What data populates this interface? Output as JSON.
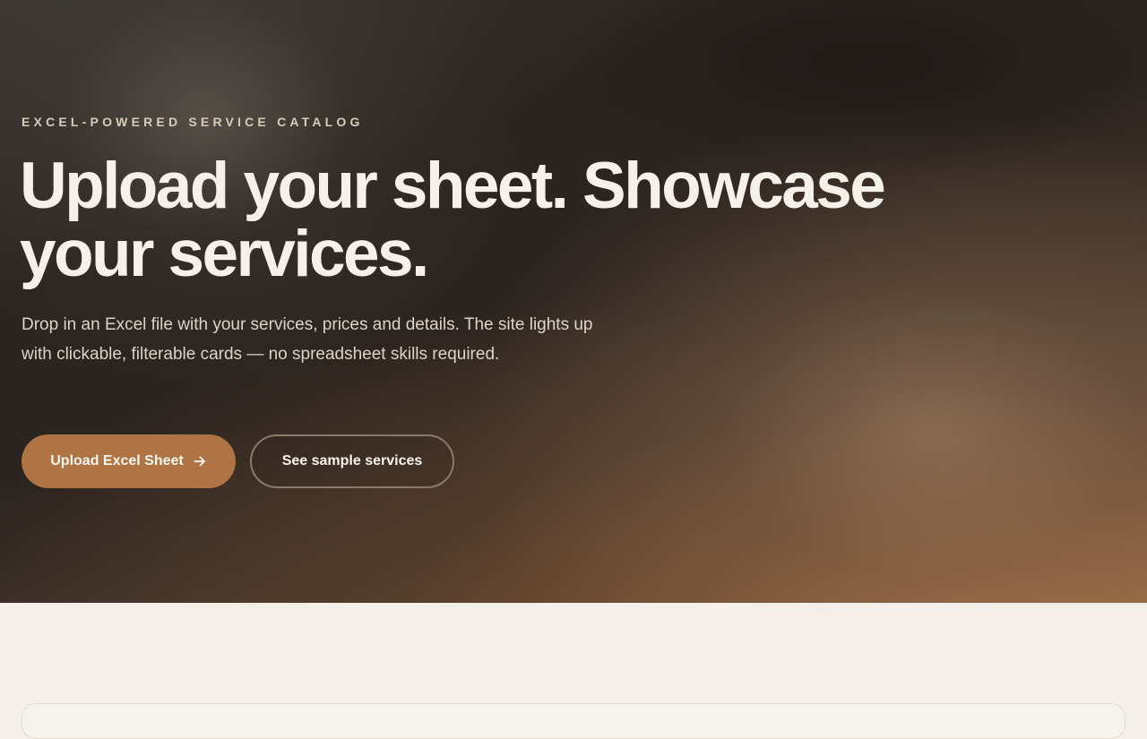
{
  "hero": {
    "eyebrow": "EXCEL-POWERED SERVICE CATALOG",
    "title": "Upload your sheet. Showcase your services.",
    "lead": "Drop in an Excel file with your services, prices and details. The site lights up with clickable, filterable cards — no spreadsheet skills required.",
    "primary_button": {
      "label": "Upload Excel Sheet",
      "icon": "arrow-right-icon"
    },
    "secondary_button": {
      "label": "See sample services"
    }
  },
  "colors": {
    "accent": "#ae7443",
    "page_background": "#f4f0e9",
    "hero_dark": "#2a2420",
    "headline": "#f5f1ea"
  }
}
